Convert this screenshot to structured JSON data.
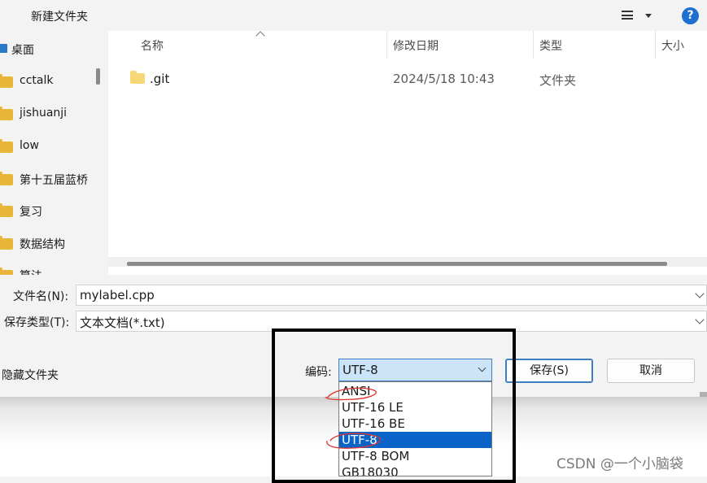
{
  "toolbar": {
    "new_folder": "新建文件夹",
    "view_icon": "view-list-icon",
    "help": "?"
  },
  "nav": {
    "items": [
      {
        "label": "桌面",
        "icon": "desktop-icon"
      },
      {
        "label": "cctalk",
        "icon": "folder-icon"
      },
      {
        "label": "jishuanji",
        "icon": "folder-icon"
      },
      {
        "label": "low",
        "icon": "folder-icon"
      },
      {
        "label": "第十五届蓝桥",
        "icon": "folder-icon"
      },
      {
        "label": "复习",
        "icon": "folder-icon"
      },
      {
        "label": "数据结构",
        "icon": "folder-icon"
      },
      {
        "label": "算法",
        "icon": "folder-icon"
      }
    ]
  },
  "columns": {
    "name": "名称",
    "modified": "修改日期",
    "type": "类型",
    "size": "大小"
  },
  "files": [
    {
      "name": ".git",
      "modified": "2024/5/18 10:43",
      "type": "文件夹"
    }
  ],
  "form": {
    "filename_label": "文件名(N):",
    "filename_value": "mylabel.cpp",
    "filetype_label": "保存类型(T):",
    "filetype_value": "文本文档(*.txt)"
  },
  "bottom": {
    "hide_folders": "隐藏文件夹",
    "encoding_label": "编码:",
    "encoding_value": "UTF-8",
    "save_label": "保存(S)",
    "cancel_label": "取消"
  },
  "encoding_options": [
    "ANSI",
    "UTF-16 LE",
    "UTF-16 BE",
    "UTF-8",
    "UTF-8 BOM",
    "GB18030"
  ],
  "encoding_selected": "UTF-8",
  "annotation_color": "#e0322e",
  "accent_color": "#0a64c8",
  "watermark": "CSDN @一个小脑袋"
}
